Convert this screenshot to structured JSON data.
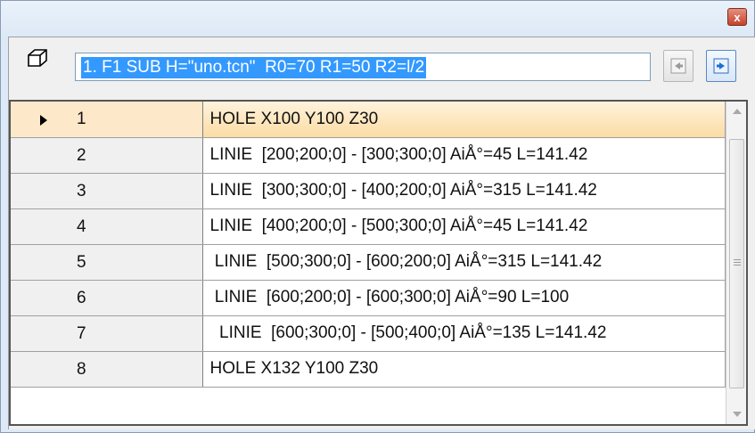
{
  "window": {
    "close_label": "x"
  },
  "command": {
    "value": "1. F1 SUB H=\"uno.tcn\"  R0=70 R1=50 R2=l/2"
  },
  "icons": {
    "cube": "cube-icon",
    "prev": "arrow-left-icon",
    "next": "arrow-right-icon",
    "current_row": "triangle-right-icon",
    "scroll_up": "triangle-up-icon",
    "scroll_down": "triangle-down-icon"
  },
  "rows": [
    {
      "num": "1",
      "text": "HOLE X100 Y100 Z30"
    },
    {
      "num": "2",
      "text": "LINIE  [200;200;0] - [300;300;0] AiÅ°=45 L=141.42"
    },
    {
      "num": "3",
      "text": "LINIE  [300;300;0] - [400;200;0] AiÅ°=315 L=141.42"
    },
    {
      "num": "4",
      "text": "LINIE  [400;200;0] - [500;300;0] AiÅ°=45 L=141.42"
    },
    {
      "num": "5",
      "text": " LINIE  [500;300;0] - [600;200;0] AiÅ°=315 L=141.42"
    },
    {
      "num": "6",
      "text": " LINIE  [600;200;0] - [600;300;0] AiÅ°=90 L=100"
    },
    {
      "num": "7",
      "text": "  LINIE  [600;300;0] - [500;400;0] AiÅ°=135 L=141.42"
    },
    {
      "num": "8",
      "text": "HOLE X132 Y100 Z30"
    }
  ],
  "colors": {
    "selection": "#3399ff",
    "active_row": "#fbdca4",
    "title_bar": "#dde9f6"
  }
}
